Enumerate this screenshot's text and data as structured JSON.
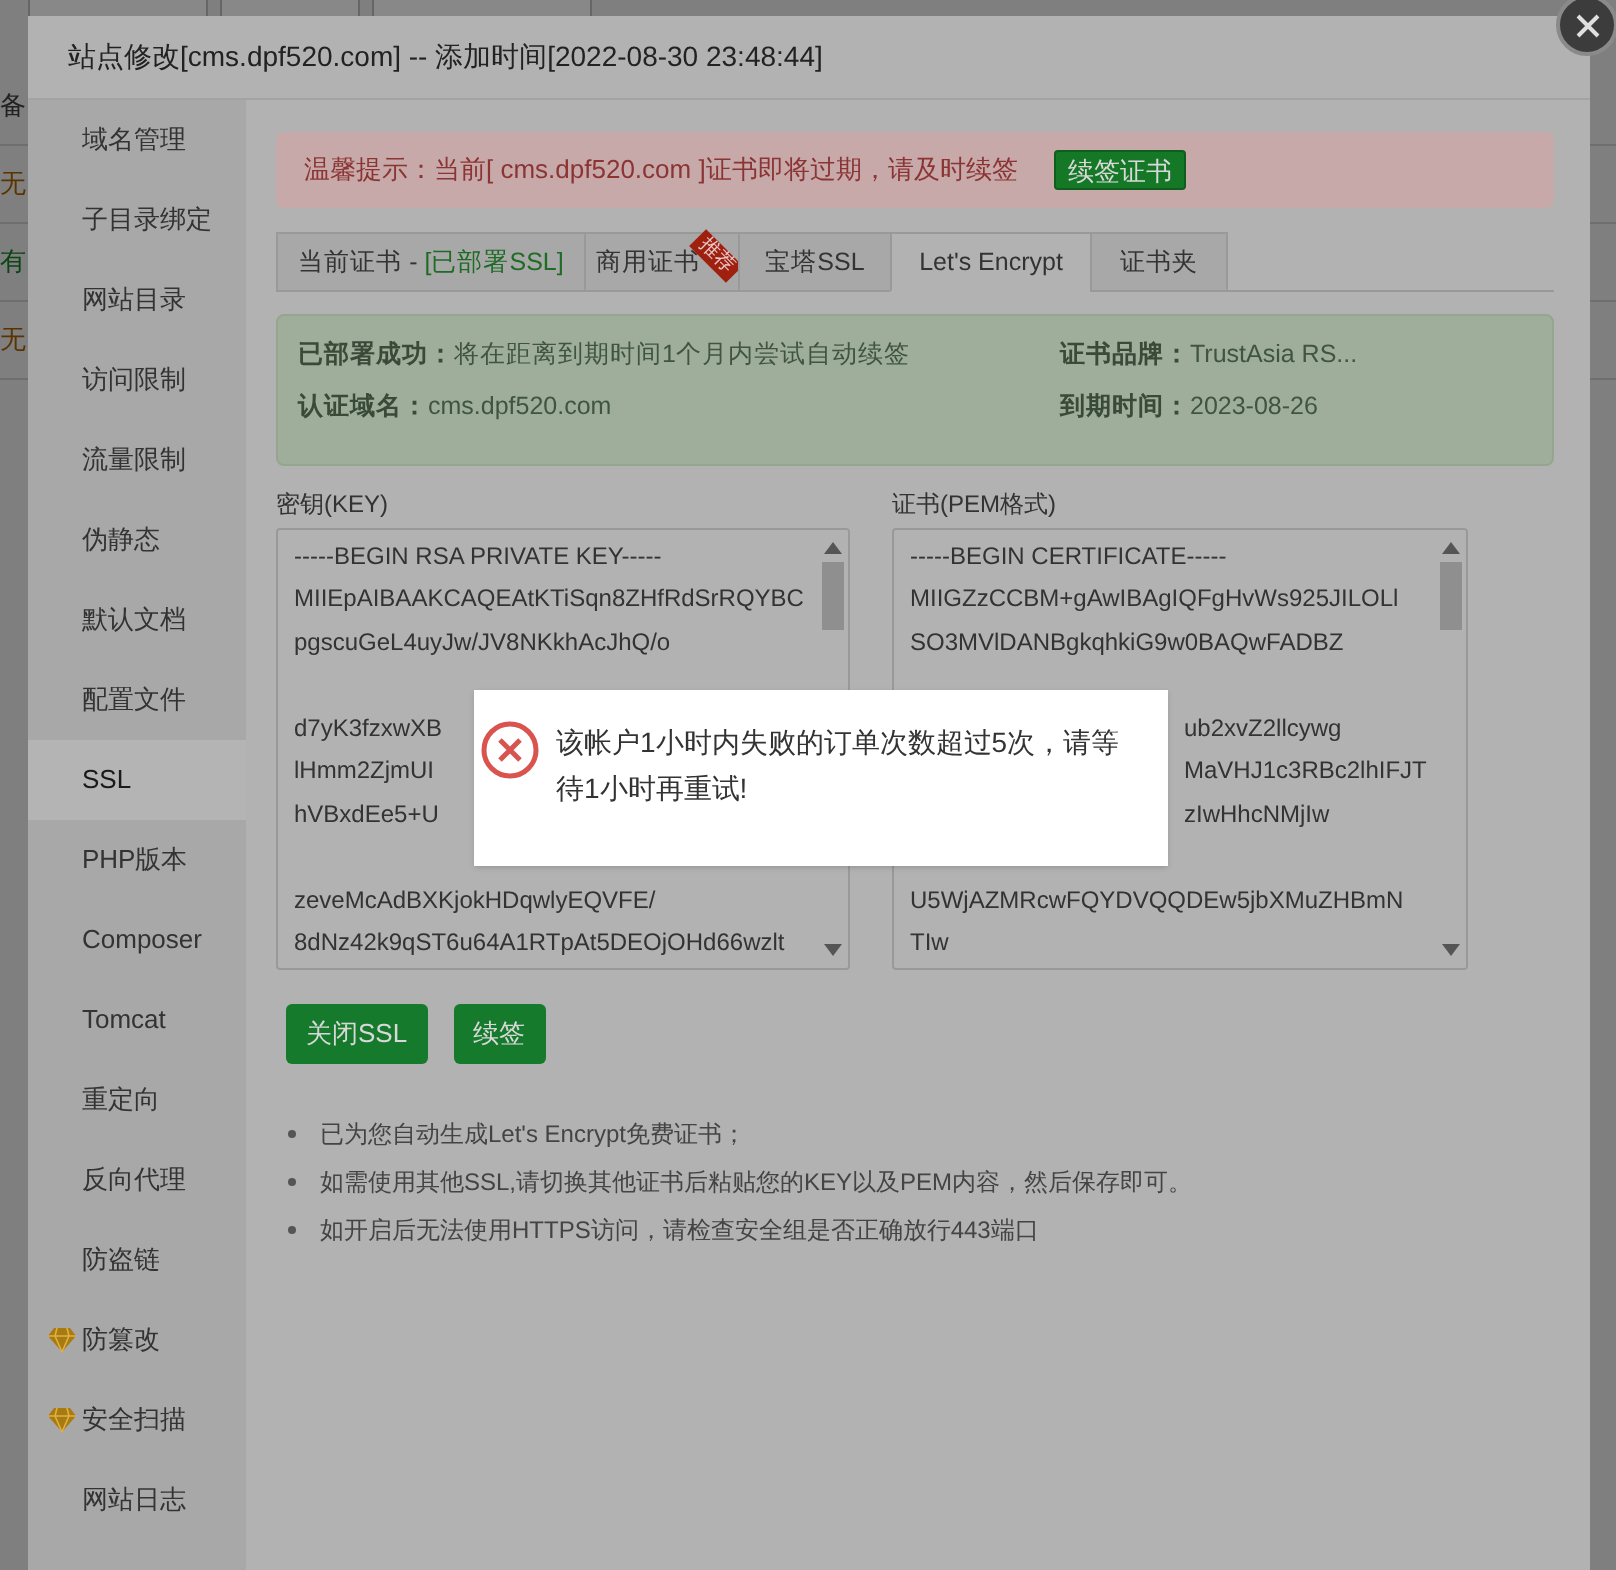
{
  "background_page": {
    "rows": [
      {
        "text": "备",
        "kind": "plain"
      },
      {
        "text": "无",
        "kind": "warn"
      },
      {
        "text": "有",
        "kind": "ok"
      },
      {
        "text": "无",
        "kind": "warn"
      }
    ]
  },
  "window": {
    "title": "站点修改[cms.dpf520.com] -- 添加时间[2022-08-30 23:48:44]"
  },
  "sidebar": {
    "items": [
      {
        "label": "域名管理",
        "selected": false,
        "premium": false
      },
      {
        "label": "子目录绑定",
        "selected": false,
        "premium": false
      },
      {
        "label": "网站目录",
        "selected": false,
        "premium": false
      },
      {
        "label": "访问限制",
        "selected": false,
        "premium": false
      },
      {
        "label": "流量限制",
        "selected": false,
        "premium": false
      },
      {
        "label": "伪静态",
        "selected": false,
        "premium": false
      },
      {
        "label": "默认文档",
        "selected": false,
        "premium": false
      },
      {
        "label": "配置文件",
        "selected": false,
        "premium": false
      },
      {
        "label": "SSL",
        "selected": true,
        "premium": false
      },
      {
        "label": "PHP版本",
        "selected": false,
        "premium": false
      },
      {
        "label": "Composer",
        "selected": false,
        "premium": false
      },
      {
        "label": "Tomcat",
        "selected": false,
        "premium": false
      },
      {
        "label": "重定向",
        "selected": false,
        "premium": false
      },
      {
        "label": "反向代理",
        "selected": false,
        "premium": false
      },
      {
        "label": "防盗链",
        "selected": false,
        "premium": false
      },
      {
        "label": "防篡改",
        "selected": false,
        "premium": true
      },
      {
        "label": "安全扫描",
        "selected": false,
        "premium": true
      },
      {
        "label": "网站日志",
        "selected": false,
        "premium": false
      }
    ]
  },
  "alert": {
    "text": "温馨提示：当前[ cms.dpf520.com ]证书即将过期，请及时续签",
    "button": "续签证书"
  },
  "tabs": [
    {
      "label": "当前证书 - ",
      "status": "[已部署SSL]",
      "selected": false
    },
    {
      "label": "商用证书",
      "ribbon": "推荐",
      "selected": false
    },
    {
      "label": "宝塔SSL",
      "selected": false
    },
    {
      "label": "Let's Encrypt",
      "selected": true
    },
    {
      "label": "证书夹",
      "selected": false
    }
  ],
  "status_panel": {
    "left": [
      {
        "label": "已部署成功：",
        "value": "将在距离到期时间1个月内尝试自动续签"
      },
      {
        "label": "认证域名：",
        "value": "cms.dpf520.com"
      }
    ],
    "right": [
      {
        "label": "证书品牌：",
        "value": "TrustAsia RS..."
      },
      {
        "label": "到期时间：",
        "value": "2023-08-26"
      }
    ]
  },
  "key_field": {
    "label": "密钥(KEY)",
    "lines": [
      {
        "text": "-----BEGIN RSA PRIVATE KEY-----",
        "kind": "full"
      },
      {
        "text": "MIIEpAIBAAKCAQEAtKTiSqn8ZHfRdSrRQYBC",
        "kind": "full"
      },
      {
        "text": "pgscuGeL4uyJw/JV8NKkhAcJhQ/o",
        "kind": "full"
      },
      {
        "kind": "gap"
      },
      {
        "text": "d7yK3fzxwXB",
        "kind": "full"
      },
      {
        "text": "lHmm2ZjmUI",
        "kind": "full"
      },
      {
        "text": "hVBxdEe5+U",
        "kind": "full"
      },
      {
        "kind": "gap"
      },
      {
        "text": "zeveMcAdBXKjokHDqwlyEQVFE/",
        "kind": "full"
      },
      {
        "text": "8dNz42k9qST6u64A1RTpAt5DEOjOHd66wzlt",
        "kind": "full"
      }
    ]
  },
  "cert_field": {
    "label": "证书(PEM格式)",
    "lines": [
      {
        "text": "-----BEGIN CERTIFICATE-----",
        "kind": "full"
      },
      {
        "text": "MIIGZzCCBM+gAwIBAgIQFgHvWs925JILOLl",
        "kind": "full"
      },
      {
        "text": "SO3MVlDANBgkqhkiG9w0BAQwFADBZ",
        "kind": "full"
      },
      {
        "kind": "gap"
      },
      {
        "text": "ub2xvZ2llcywg",
        "kind": "tail"
      },
      {
        "text": "MaVHJ1c3RBc2lhIFJT",
        "kind": "tail"
      },
      {
        "text": "zIwHhcNMjIw",
        "kind": "tail"
      },
      {
        "kind": "gap"
      },
      {
        "text": "U5WjAZMRcwFQYDVQQDEw5jbXMuZHBmN",
        "kind": "full"
      },
      {
        "text": "TIw",
        "kind": "full"
      }
    ]
  },
  "buttons": [
    "关闭SSL",
    "续签"
  ],
  "notes": [
    "已为您自动生成Let's Encrypt免费证书；",
    "如需使用其他SSL,请切换其他证书后粘贴您的KEY以及PEM内容，然后保存即可。",
    "如开启后无法使用HTTPS访问，请检查安全组是否正确放行443端口"
  ],
  "message_dialog": {
    "text": "该帐户1小时内失败的订单次数超过5次，请等待1小时再重试!",
    "kind": "error"
  }
}
